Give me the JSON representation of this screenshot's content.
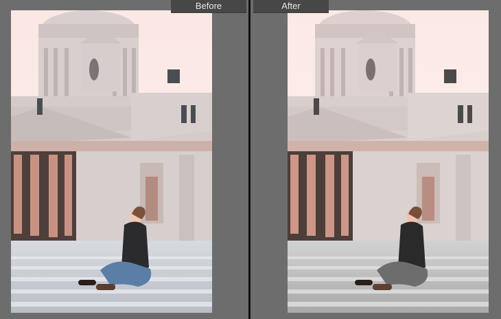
{
  "compare_view": {
    "before_label": "Before",
    "after_label": "After"
  },
  "colors": {
    "window_background": "#6b6b6b",
    "label_background": "#474747",
    "label_text": "#e6e6e6",
    "divider": "#111111"
  }
}
